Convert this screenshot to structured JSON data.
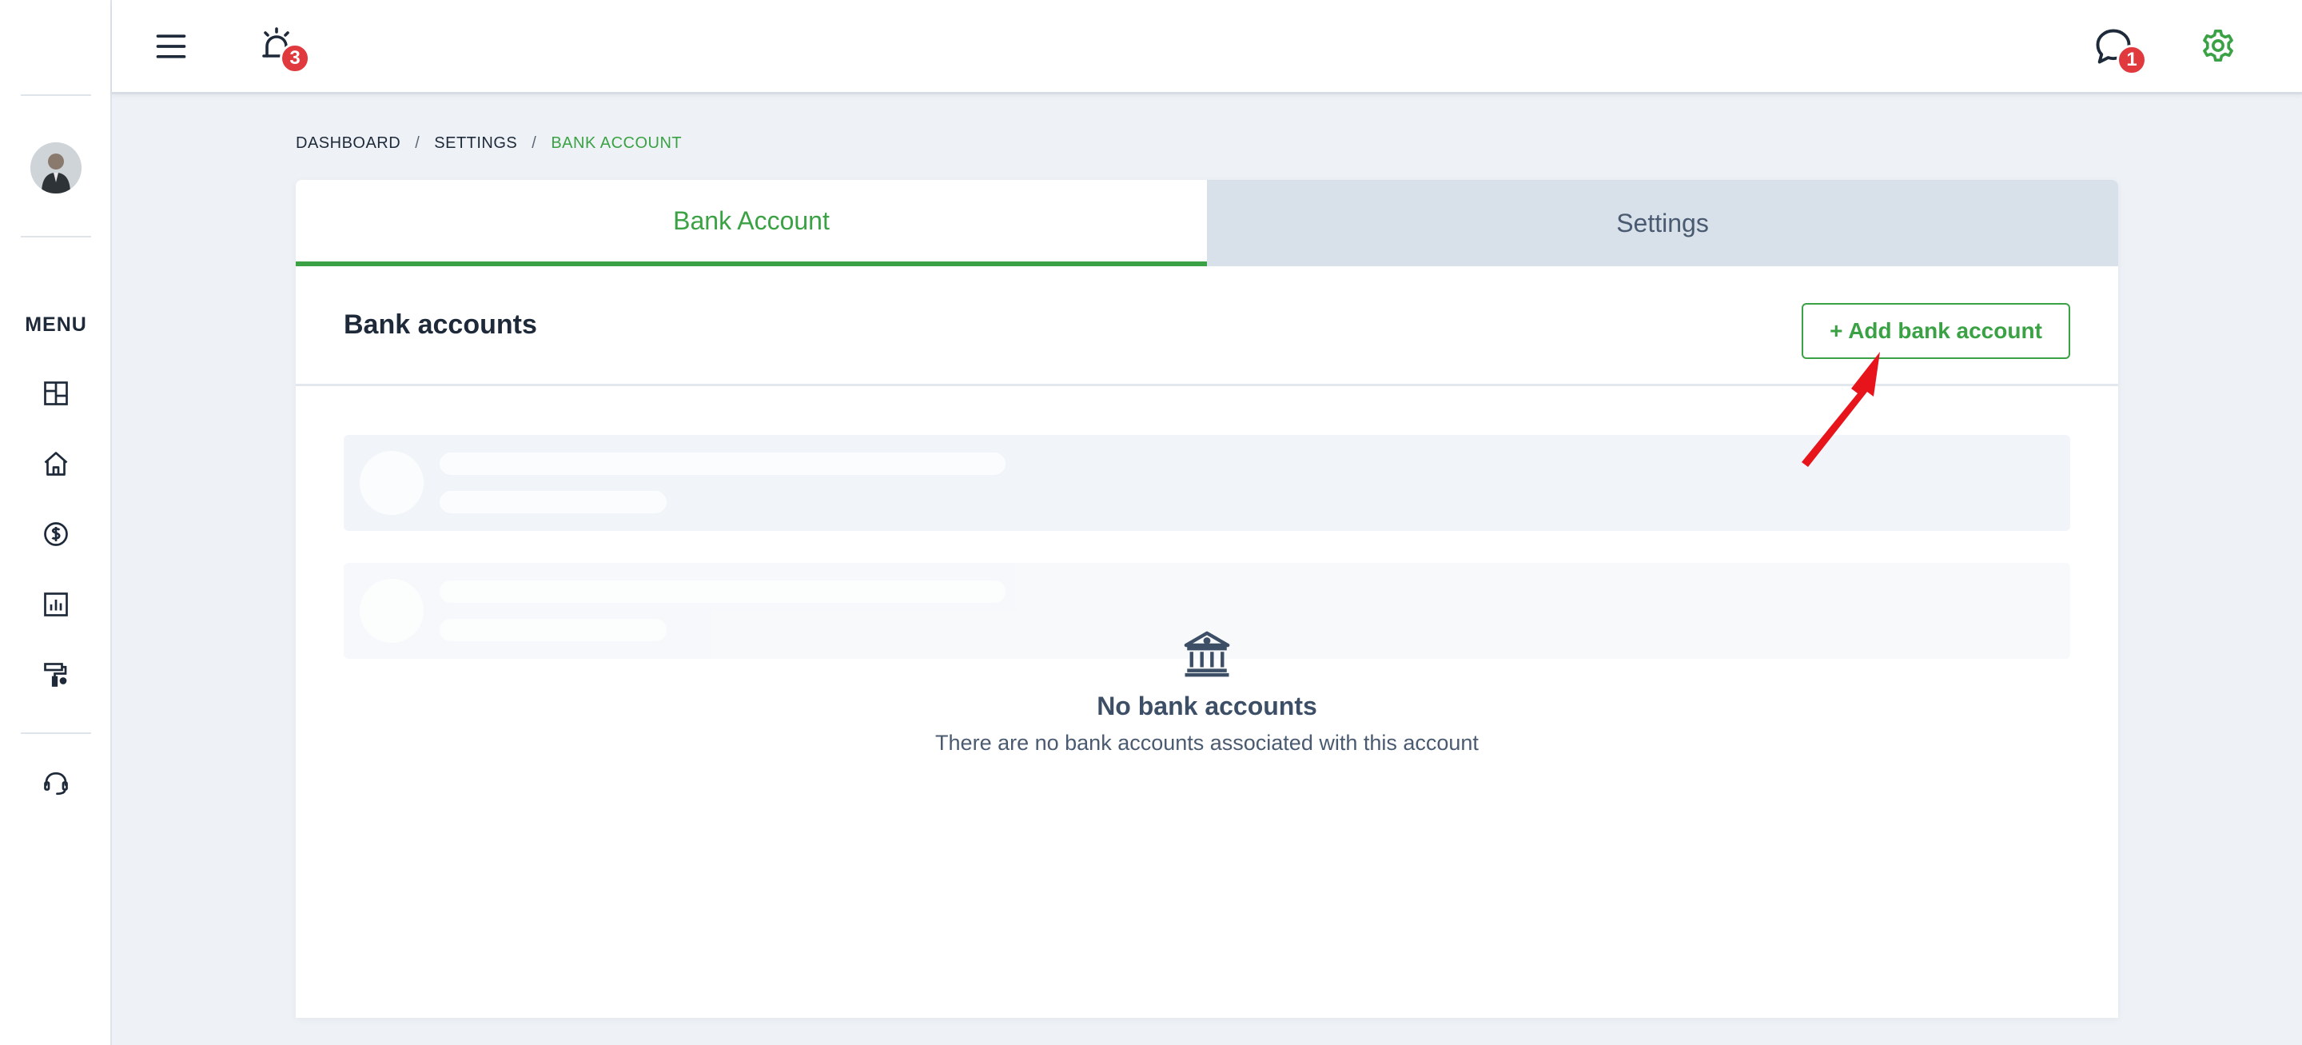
{
  "notifications": {
    "count": "3"
  },
  "messages": {
    "count": "1"
  },
  "sidebar": {
    "menu_label": "MENU",
    "icons": [
      "dashboard-icon",
      "home-icon",
      "dollar-icon",
      "chart-icon",
      "paint-roller-icon",
      "headset-icon"
    ]
  },
  "breadcrumb": {
    "items": [
      "DASHBOARD",
      "SETTINGS",
      "BANK ACCOUNT"
    ],
    "separator": "/"
  },
  "tabs": [
    {
      "label": "Bank Account",
      "active": true
    },
    {
      "label": "Settings",
      "active": false
    }
  ],
  "section": {
    "title": "Bank accounts",
    "add_button": "+ Add bank account"
  },
  "empty_state": {
    "icon": "bank-icon",
    "title": "No bank accounts",
    "text": "There are no bank accounts associated with this account"
  },
  "colors": {
    "accent": "#3aa244",
    "badge": "#e0393e",
    "background": "#eef2f6",
    "annotation_arrow": "#e8141c"
  }
}
